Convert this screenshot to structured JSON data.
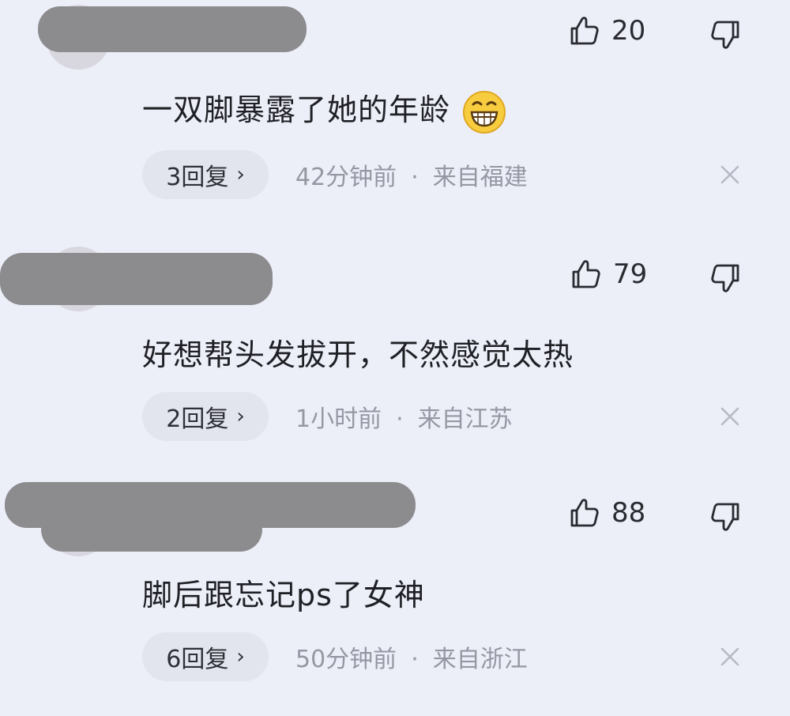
{
  "comments": [
    {
      "like_count": "20",
      "text": "一双脚暴露了她的年龄",
      "emoji": "grinning-face-emoji",
      "reply_label": "3回复",
      "time": "42分钟前",
      "location": "来自福建"
    },
    {
      "like_count": "79",
      "text": "好想帮头发拔开，不然感觉太热",
      "reply_label": "2回复",
      "time": "1小时前",
      "location": "来自江苏"
    },
    {
      "like_count": "88",
      "text": "脚后跟忘记ps了女神",
      "reply_label": "6回复",
      "time": "50分钟前",
      "location": "来自浙江"
    }
  ],
  "icons": {
    "like": "thumbs-up-icon",
    "dislike": "thumbs-down-icon",
    "close": "close-icon",
    "chevron": "chevron-right-icon"
  },
  "colors": {
    "background": "#eceef8",
    "text_primary": "#1f2025",
    "text_secondary": "#9597a3",
    "pill": "#e2e4ee",
    "redaction": "#8c8c8f"
  },
  "labels": {
    "separator": "·",
    "chevron": "›"
  }
}
